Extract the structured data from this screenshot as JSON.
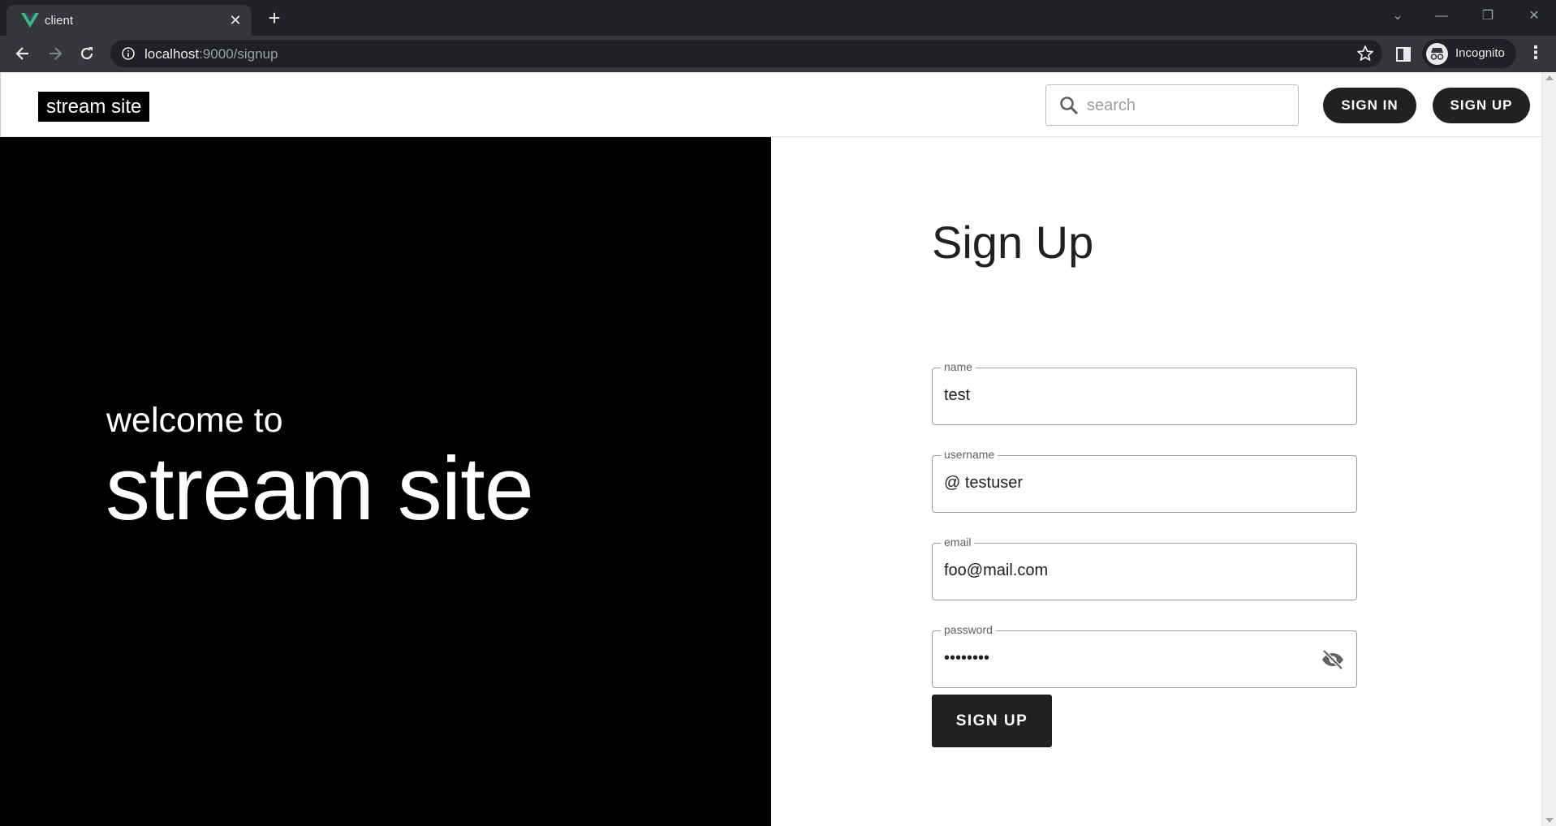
{
  "browser": {
    "tab_title": "client",
    "url_host": "localhost",
    "url_rest": ":9000/signup",
    "profile_label": "Incognito"
  },
  "header": {
    "logo": "stream site",
    "search_placeholder": "search",
    "sign_in_label": "SIGN IN",
    "sign_up_label": "SIGN UP"
  },
  "hero": {
    "subtitle": "welcome to",
    "title": "stream site"
  },
  "form": {
    "title": "Sign Up",
    "fields": [
      {
        "label": "name",
        "value": "test"
      },
      {
        "label": "username",
        "value": "@ testuser"
      },
      {
        "label": "email",
        "value": "foo@mail.com"
      },
      {
        "label": "password",
        "value": "••••••••"
      }
    ],
    "submit_label": "SIGN UP"
  },
  "colors": {
    "accent": "#212121",
    "hero_bg": "#000000",
    "vue_green": "#41b883"
  }
}
